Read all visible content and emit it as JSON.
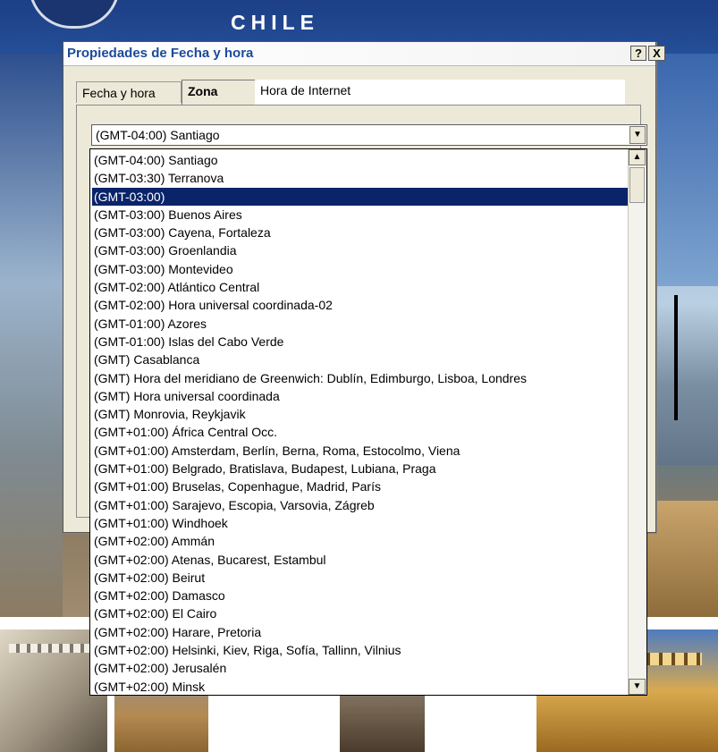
{
  "background": {
    "brand_text": "CHILE"
  },
  "dialog": {
    "title": "Propiedades de Fecha y hora",
    "help_button": "?",
    "close_button": "X",
    "tabs": [
      {
        "label": "Fecha y hora"
      },
      {
        "label": "Zona horaria"
      },
      {
        "label": "Hora de Internet"
      }
    ],
    "timezone_combo": {
      "value": "(GMT-04:00) Santiago"
    }
  },
  "dropdown": {
    "selected_index": 2,
    "items": [
      "(GMT-04:00) Santiago",
      "(GMT-03:30) Terranova",
      "(GMT-03:00)",
      "(GMT-03:00) Buenos Aires",
      "(GMT-03:00) Cayena, Fortaleza",
      "(GMT-03:00) Groenlandia",
      "(GMT-03:00) Montevideo",
      "(GMT-02:00) Atlántico Central",
      "(GMT-02:00) Hora universal coordinada-02",
      "(GMT-01:00) Azores",
      "(GMT-01:00) Islas del Cabo Verde",
      "(GMT) Casablanca",
      "(GMT) Hora del meridiano de Greenwich: Dublín, Edimburgo, Lisboa, Londres",
      "(GMT) Hora universal coordinada",
      "(GMT) Monrovia, Reykjavik",
      "(GMT+01:00) África Central Occ.",
      "(GMT+01:00) Amsterdam, Berlín, Berna, Roma, Estocolmo, Viena",
      "(GMT+01:00) Belgrado, Bratislava, Budapest, Lubiana, Praga",
      "(GMT+01:00) Bruselas, Copenhague, Madrid, París",
      "(GMT+01:00) Sarajevo, Escopia, Varsovia, Zágreb",
      "(GMT+01:00) Windhoek",
      "(GMT+02:00) Ammán",
      "(GMT+02:00) Atenas, Bucarest, Estambul",
      "(GMT+02:00) Beirut",
      "(GMT+02:00) Damasco",
      "(GMT+02:00) El Cairo",
      "(GMT+02:00) Harare, Pretoria",
      "(GMT+02:00) Helsinki, Kiev, Riga, Sofía, Tallinn, Vilnius",
      "(GMT+02:00) Jerusalén",
      "(GMT+02:00) Minsk"
    ]
  },
  "scrollbar": {
    "up": "▲",
    "down": "▼"
  },
  "colors": {
    "selection": "#0a246a",
    "dialog_bg": "#ece9d8",
    "title_text": "#1c4a9a"
  }
}
